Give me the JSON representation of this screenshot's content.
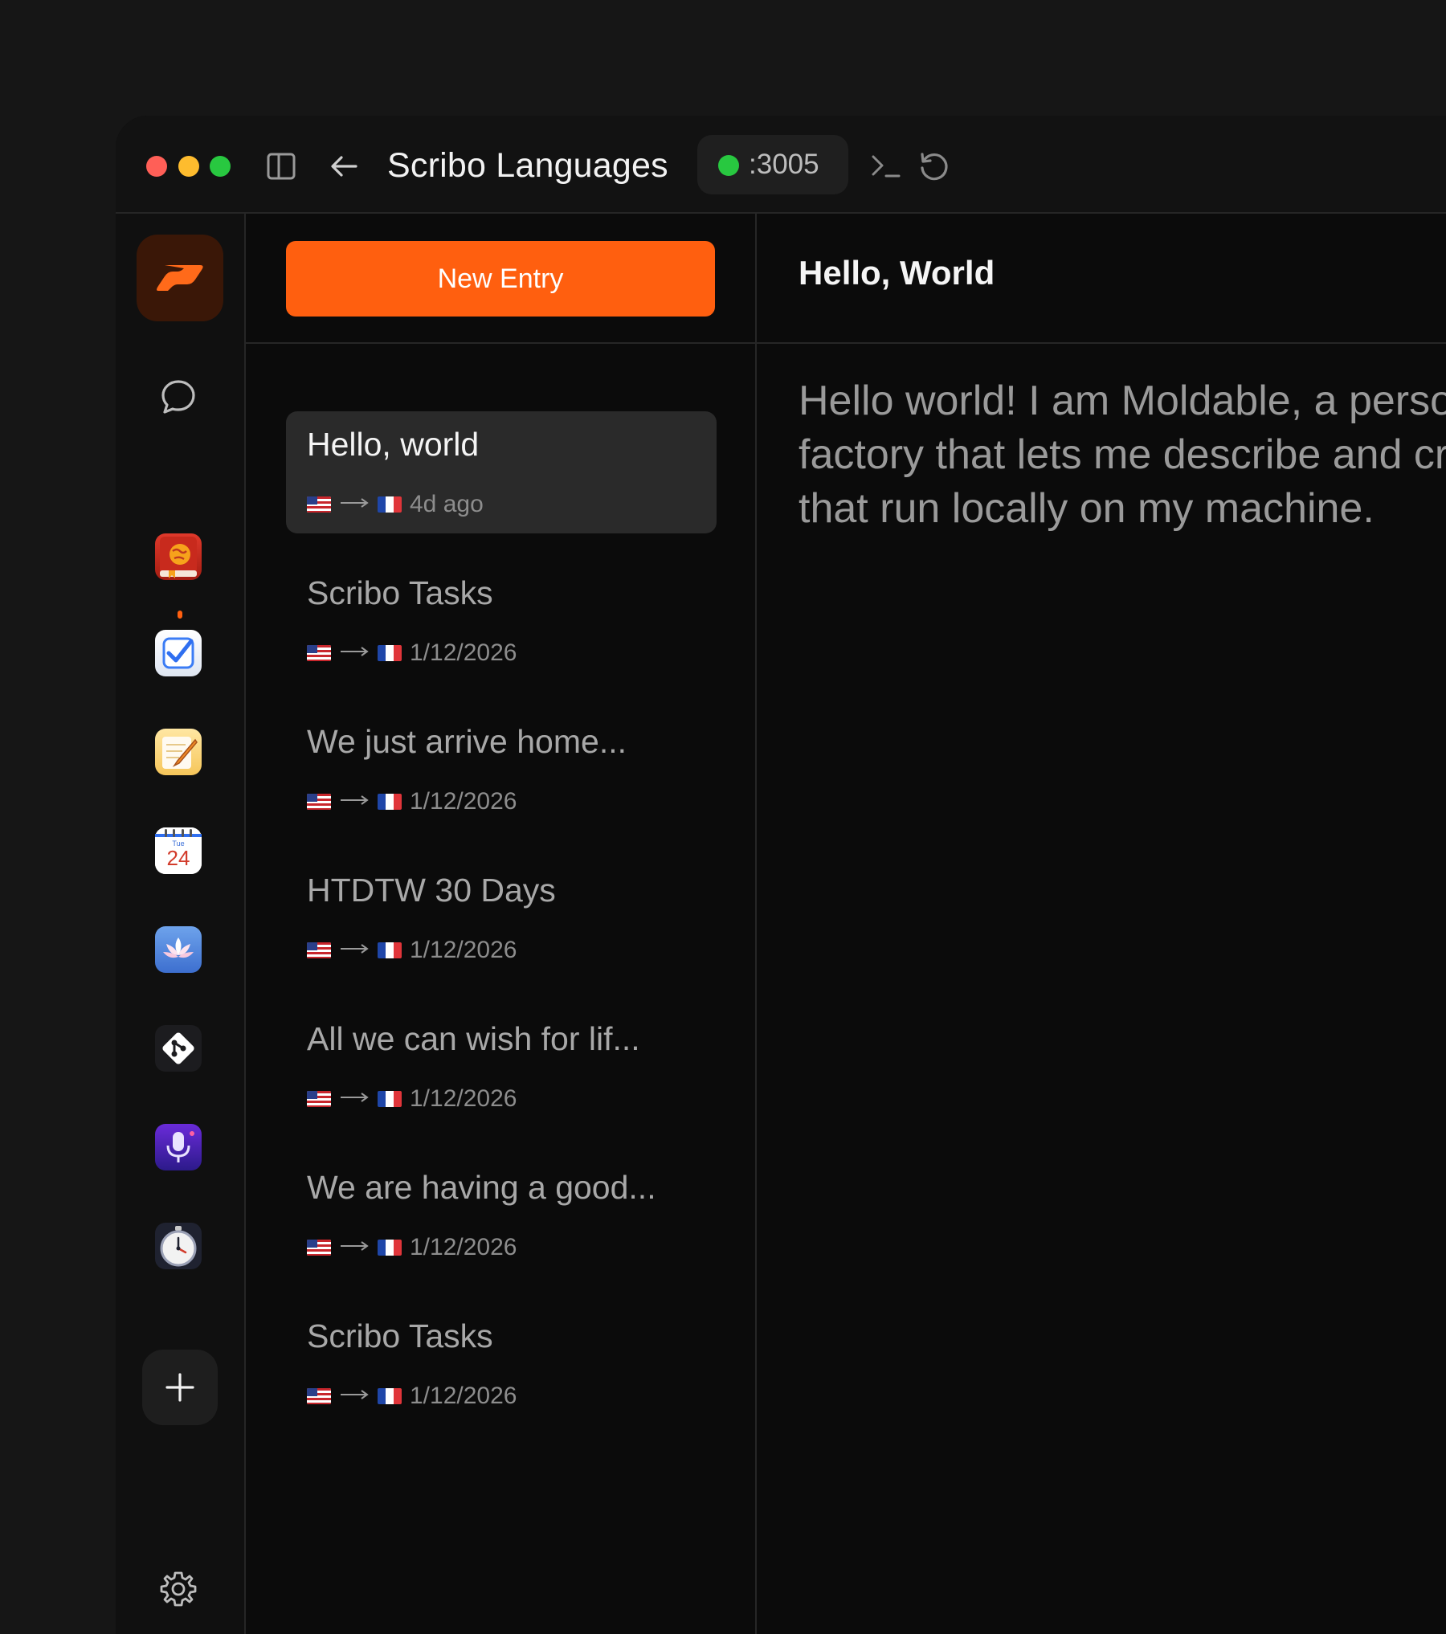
{
  "window": {
    "title": "Scribo Languages",
    "port": ":3005"
  },
  "toolbar": {
    "icons": [
      "sidebar-toggle-icon",
      "back-arrow-icon",
      "terminal-icon",
      "reload-icon"
    ]
  },
  "rail": {
    "items": [
      {
        "name": "scribo-app",
        "icon": "scribo-logo-icon",
        "active": true
      },
      {
        "name": "chat",
        "icon": "chat-bubble-icon"
      },
      {
        "name": "languages",
        "icon": "globe-book-icon"
      },
      {
        "name": "tasks",
        "icon": "checkbox-icon"
      },
      {
        "name": "notes",
        "icon": "notepad-icon"
      },
      {
        "name": "calendar",
        "icon": "calendar-icon",
        "day_label": "Tue",
        "date_number": "24"
      },
      {
        "name": "meditation",
        "icon": "lotus-icon"
      },
      {
        "name": "git",
        "icon": "git-icon"
      },
      {
        "name": "voice",
        "icon": "microphone-icon"
      },
      {
        "name": "timer",
        "icon": "stopwatch-icon"
      }
    ],
    "add_icon": "plus-icon",
    "settings_icon": "gear-icon"
  },
  "list": {
    "new_entry_label": "New Entry",
    "entries": [
      {
        "title": "Hello, world",
        "from": "US",
        "to": "FR",
        "date": "4d ago",
        "selected": true
      },
      {
        "title": "Scribo Tasks",
        "from": "US",
        "to": "FR",
        "date": "1/12/2026"
      },
      {
        "title": "We just arrive home...",
        "from": "US",
        "to": "FR",
        "date": "1/12/2026"
      },
      {
        "title": "HTDTW 30 Days",
        "from": "US",
        "to": "FR",
        "date": "1/12/2026"
      },
      {
        "title": "All we can wish for lif...",
        "from": "US",
        "to": "FR",
        "date": "1/12/2026"
      },
      {
        "title": "We are having a good...",
        "from": "US",
        "to": "FR",
        "date": "1/12/2026"
      },
      {
        "title": "Scribo Tasks",
        "from": "US",
        "to": "FR",
        "date": "1/12/2026"
      }
    ]
  },
  "detail": {
    "title": "Hello, World",
    "body": "Hello world! I am Moldable, a personal software factory that lets me describe and create apps that run locally on my machine."
  },
  "colors": {
    "accent": "#ff5f0f",
    "status_green": "#28c840",
    "background": "#0b0b0b"
  }
}
